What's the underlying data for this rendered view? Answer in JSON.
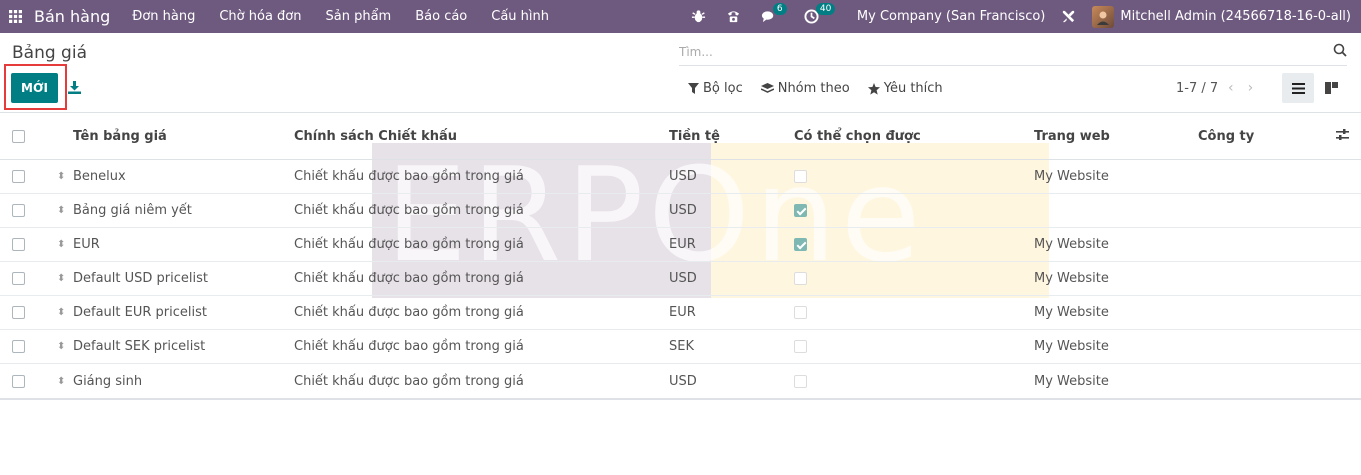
{
  "navbar": {
    "brand": "Bán hàng",
    "menu": [
      "Đơn hàng",
      "Chờ hóa đơn",
      "Sản phẩm",
      "Báo cáo",
      "Cấu hình"
    ],
    "chat_count": "6",
    "activity_count": "40",
    "company": "My Company (San Francisco)",
    "user": "Mitchell Admin (24566718-16-0-all)"
  },
  "control": {
    "title": "Bảng giá",
    "new_label": "MỚI",
    "search_placeholder": "Tìm...",
    "filter_label": "Bộ lọc",
    "group_label": "Nhóm theo",
    "favorite_label": "Yêu thích",
    "pager": "1-7 / 7"
  },
  "table": {
    "headers": {
      "name": "Tên bảng giá",
      "policy": "Chính sách Chiết khấu",
      "currency": "Tiền tệ",
      "selectable": "Có thể chọn được",
      "website": "Trang web",
      "company": "Công ty"
    },
    "rows": [
      {
        "name": "Benelux",
        "policy": "Chiết khấu được bao gồm trong giá",
        "currency": "USD",
        "selectable": false,
        "website": "My Website",
        "company": ""
      },
      {
        "name": "Bảng giá niêm yết",
        "policy": "Chiết khấu được bao gồm trong giá",
        "currency": "USD",
        "selectable": true,
        "website": "",
        "company": ""
      },
      {
        "name": "EUR",
        "policy": "Chiết khấu được bao gồm trong giá",
        "currency": "EUR",
        "selectable": true,
        "website": "My Website",
        "company": ""
      },
      {
        "name": "Default USD pricelist",
        "policy": "Chiết khấu được bao gồm trong giá",
        "currency": "USD",
        "selectable": false,
        "website": "My Website",
        "company": ""
      },
      {
        "name": "Default EUR pricelist",
        "policy": "Chiết khấu được bao gồm trong giá",
        "currency": "EUR",
        "selectable": false,
        "website": "My Website",
        "company": ""
      },
      {
        "name": "Default SEK pricelist",
        "policy": "Chiết khấu được bao gồm trong giá",
        "currency": "SEK",
        "selectable": false,
        "website": "My Website",
        "company": ""
      },
      {
        "name": "Giáng sinh",
        "policy": "Chiết khấu được bao gồm trong giá",
        "currency": "USD",
        "selectable": false,
        "website": "My Website",
        "company": ""
      }
    ]
  },
  "watermark": "ERPOne",
  "colors": {
    "navbar": "#6f5a7f",
    "primary": "#017e84",
    "highlight": "#e53b3b"
  }
}
